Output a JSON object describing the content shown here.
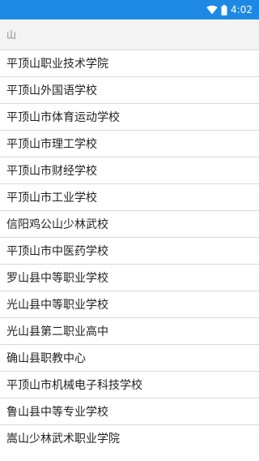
{
  "status_bar": {
    "time": "4:02",
    "icons": [
      "wifi-icon",
      "battery-icon"
    ],
    "background": "#1e88e5"
  },
  "search": {
    "value": "山"
  },
  "results": [
    "平顶山职业技术学院",
    "平顶山外国语学校",
    "平顶山市体育运动学校",
    "平顶山市理工学校",
    "平顶山市财经学校",
    "平顶山市工业学校",
    "信阳鸡公山少林武校",
    "平顶山市中医药学校",
    "罗山县中等职业学校",
    "光山县中等职业学校",
    "光山县第二职业高中",
    "确山县职教中心",
    "平顶山市机械电子科技学校",
    "鲁山县中等专业学校",
    "嵩山少林武术职业学院"
  ]
}
